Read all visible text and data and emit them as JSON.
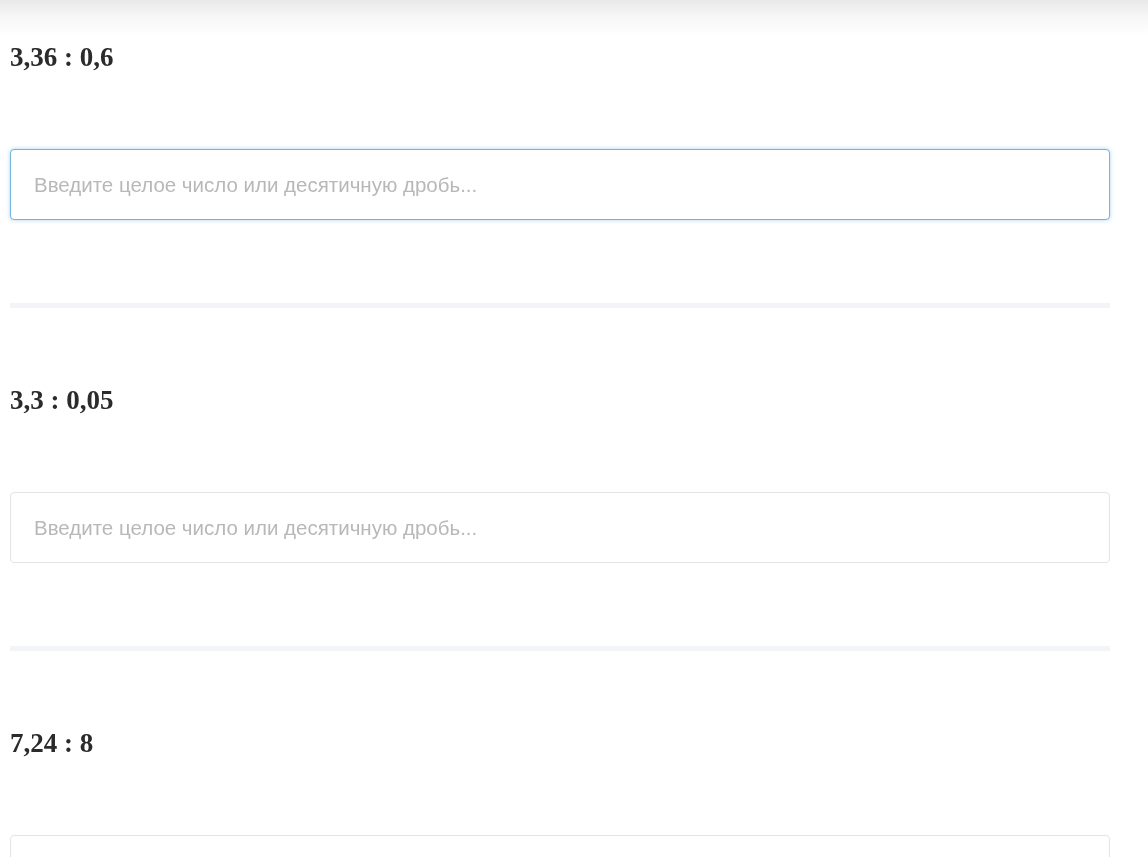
{
  "problems": [
    {
      "expression": "3,36 : 0,6",
      "answer": {
        "placeholder": "Введите целое число или десятичную дробь...",
        "focused": true
      }
    },
    {
      "expression": "3,3 : 0,05",
      "answer": {
        "placeholder": "Введите целое число или десятичную дробь...",
        "focused": false
      }
    },
    {
      "expression": "7,24 : 8",
      "answer": {
        "focused": false
      }
    }
  ]
}
